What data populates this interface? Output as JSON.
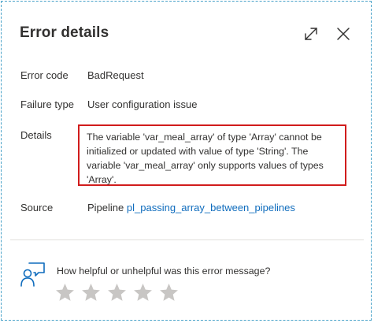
{
  "dialog": {
    "title": "Error details",
    "fields": {
      "error_code": {
        "label": "Error code",
        "value": "BadRequest"
      },
      "failure_type": {
        "label": "Failure type",
        "value": "User configuration issue"
      },
      "details": {
        "label": "Details",
        "value": "The variable 'var_meal_array' of type 'Array' cannot be initialized or updated with value of type 'String'. The variable 'var_meal_array' only supports values of types 'Array'."
      },
      "source": {
        "label": "Source",
        "prefix": "Pipeline",
        "link": "pl_passing_array_between_pipelines"
      }
    },
    "feedback": {
      "question": "How helpful or unhelpful was this error message?",
      "rating": 0,
      "max_rating": 5
    },
    "icons": {
      "expand": "expand-icon",
      "close": "close-icon",
      "feedback": "feedback-person-icon",
      "star": "star-icon"
    },
    "colors": {
      "highlight_border": "#d11c1c",
      "link": "#0f6cbd",
      "star_empty": "#c8c6c4",
      "dialog_border": "#4aa3c9"
    }
  }
}
